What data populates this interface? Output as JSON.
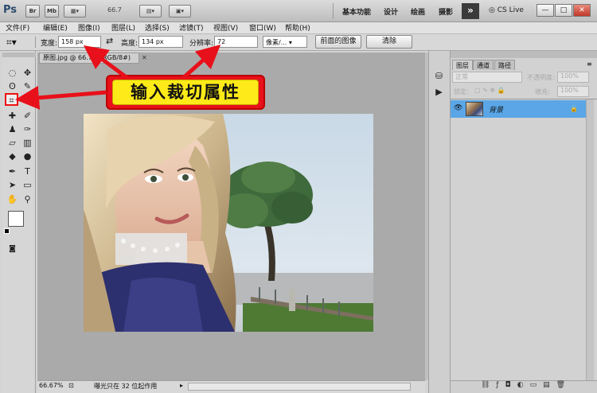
{
  "app": {
    "logo": "Ps",
    "bridge_label": "Br",
    "minibridge_label": "Mb",
    "zoom_display": "66.7",
    "workspaces": [
      "基本功能",
      "设计",
      "绘画",
      "摄影"
    ],
    "more_label": "»",
    "cs_live": "CS Live",
    "window_buttons": [
      "—",
      "□",
      "✕"
    ]
  },
  "menu": [
    "文件(F)",
    "编辑(E)",
    "图像(I)",
    "图层(L)",
    "选择(S)",
    "滤镜(T)",
    "视图(V)",
    "窗口(W)",
    "帮助(H)"
  ],
  "options": {
    "width_label": "宽度:",
    "width_value": "158 px",
    "swap_icon": "⇄",
    "height_label": "高度:",
    "height_value": "134 px",
    "resolution_label": "分辨率:",
    "resolution_value": "72",
    "unit_value": "像素/...",
    "front_image_button": "前面的图像",
    "clear_button": "清除"
  },
  "document": {
    "tab_title": "原图.jpg @ 66.7% (RGB/8#)",
    "zoom_status": "66.67%",
    "status_text": "曝光只在 32 位起作用"
  },
  "layers_panel": {
    "tabs": [
      "图层",
      "通道",
      "路径"
    ],
    "blend_mode": "正常",
    "opacity_label": "不透明度:",
    "opacity_value": "100%",
    "lock_label": "锁定:",
    "fill_label": "填充:",
    "fill_value": "100%",
    "layer_name": "背景",
    "footer_icons": [
      "link-icon",
      "fx-icon",
      "mask-icon",
      "adjustment-icon",
      "folder-icon",
      "new-layer-icon",
      "trash-icon"
    ]
  },
  "callout": {
    "text": "输入裁切属性",
    "color": "#fdea18",
    "border_color": "#e8101a"
  },
  "colors": {
    "accent_red": "#e8101a",
    "layer_selected": "#5aa6e6"
  }
}
